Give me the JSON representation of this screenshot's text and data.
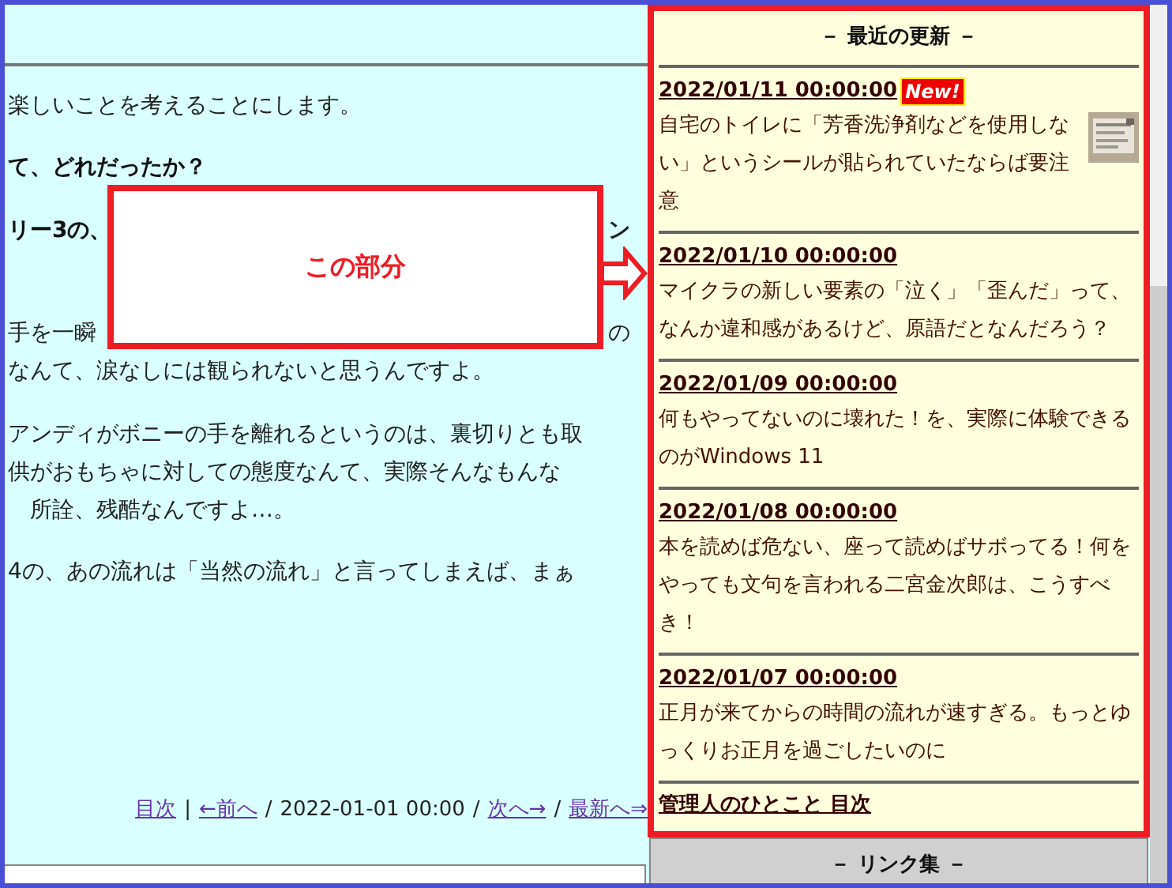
{
  "article": {
    "paragraphs": [
      {
        "bold": false,
        "lines": [
          "楽しいことを考えることにします。"
        ]
      },
      {
        "bold": true,
        "lines": [
          "て、どれだったか？"
        ]
      },
      {
        "bold": true,
        "lines": [
          "リー3の、"
        ],
        "right_text": "ン"
      },
      {
        "bold": false,
        "lines": [
          "手を一瞬",
          "なんて、涙なしには観られないと思うんですよ。"
        ],
        "right_text": "の"
      },
      {
        "bold": false,
        "lines": [
          "アンディがボニーの手を離れるというのは、裏切りとも取",
          "供がおもちゃに対しての態度なんて、実際そんなもんな",
          "　所詮、残酷なんですよ…。"
        ]
      },
      {
        "bold": false,
        "lines": [
          "4の、あの流れは「当然の流れ」と言ってしまえば、まぁ"
        ]
      }
    ],
    "nav": [
      {
        "kind": "link",
        "text": "目次"
      },
      {
        "kind": "sep",
        "text": "|"
      },
      {
        "kind": "link",
        "text": "←前へ"
      },
      {
        "kind": "sep",
        "text": "/"
      },
      {
        "kind": "text",
        "text": "2022-01-01 00:00"
      },
      {
        "kind": "sep",
        "text": "/"
      },
      {
        "kind": "link",
        "text": "次へ→"
      },
      {
        "kind": "sep",
        "text": "/"
      },
      {
        "kind": "link",
        "text": "最新へ⇒"
      }
    ]
  },
  "callout": {
    "label": "この部分"
  },
  "recent_updates": {
    "title": "－ 最近の更新 －",
    "entries": [
      {
        "date": "2022/01/11 00:00:00",
        "new_badge": "New!",
        "text": "自宅のトイレに「芳香洗浄剤などを使用しない」というシールが貼られていたならば要注意",
        "thumbnail": true
      },
      {
        "date": "2022/01/10 00:00:00",
        "text": "マイクラの新しい要素の「泣く」「歪んだ」って、なんか違和感があるけど、原語だとなんだろう？",
        "thumbnail": false
      },
      {
        "date": "2022/01/09 00:00:00",
        "text": "何もやってないのに壊れた！を、実際に体験できるのがWindows 11",
        "thumbnail": false
      },
      {
        "date": "2022/01/08 00:00:00",
        "text": "本を読めば危ない、座って読めばサボってる！何をやっても文句を言われる二宮金次郎は、こうすべき！",
        "thumbnail": false
      },
      {
        "date": "2022/01/07 00:00:00",
        "text": "正月が来てからの時間の流れが速すぎる。もっとゆっくりお正月を過ごしたいのに",
        "thumbnail": false
      }
    ],
    "footer_link": "管理人のひとこと 目次"
  },
  "links": {
    "title": "－ リンク集 －"
  }
}
